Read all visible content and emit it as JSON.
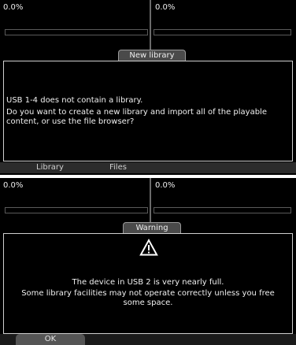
{
  "screen1": {
    "deck_left_pct": "0.0%",
    "deck_right_pct": "0.0%",
    "dialog_title": "New library",
    "message_line1": "USB 1-4 does not contain a library.",
    "message_line2": "Do you want to create a new library and import all of the playable",
    "message_line3": "content, or use the file browser?",
    "button_library": "Library",
    "button_files": "Files"
  },
  "screen2": {
    "deck_left_pct": "0.0%",
    "deck_right_pct": "0.0%",
    "dialog_title": "Warning",
    "icon": "warning-triangle-icon",
    "message_line1": "The device in USB 2 is very nearly full.",
    "message_line2": "Some library facilities may not operate correctly unless you free",
    "message_line3": "some space.",
    "button_ok": "OK"
  }
}
